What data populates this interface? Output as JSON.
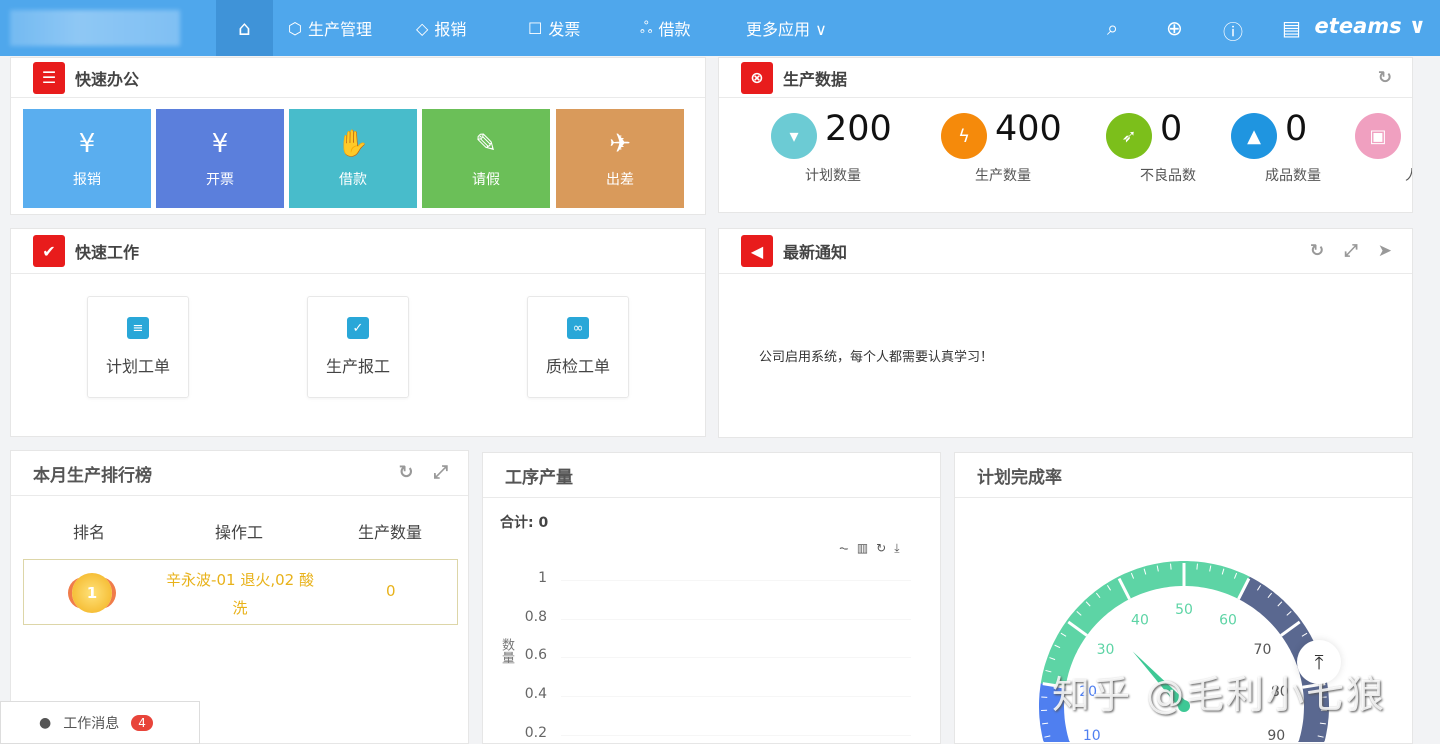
{
  "nav": {
    "items": [
      {
        "label": "生产管理",
        "icon": "cube-icon"
      },
      {
        "label": "报销",
        "icon": "diamond-icon"
      },
      {
        "label": "发票",
        "icon": "invoice-icon"
      },
      {
        "label": "借款",
        "icon": "org-icon"
      },
      {
        "label": "更多应用 ∨",
        "icon": ""
      }
    ],
    "brand": "eteams ∨"
  },
  "quick_office": {
    "title": "快速办公",
    "tiles": [
      {
        "label": "报销",
        "glyph": "¥",
        "color": "#5aaeef"
      },
      {
        "label": "开票",
        "glyph": "¥",
        "color": "#5b7fdc"
      },
      {
        "label": "借款",
        "glyph": "✋",
        "color": "#48bccb"
      },
      {
        "label": "请假",
        "glyph": "✎",
        "color": "#6bbf58"
      },
      {
        "label": "出差",
        "glyph": "✈",
        "color": "#d99a5b"
      }
    ]
  },
  "production_data": {
    "title": "生产数据",
    "stats": [
      {
        "value": "200",
        "label": "计划数量",
        "color": "#6ccbd4",
        "glyph": "▾"
      },
      {
        "value": "400",
        "label": "生产数量",
        "color": "#f58a0b",
        "glyph": "ϟ"
      },
      {
        "value": "0",
        "label": "不良品数",
        "color": "#7cbf1b",
        "glyph": "➶"
      },
      {
        "value": "0",
        "label": "成品数量",
        "color": "#1f95e0",
        "glyph": "▲"
      },
      {
        "value": "",
        "label": "人",
        "color": "#f0a0c0",
        "glyph": "▣"
      }
    ]
  },
  "quick_work": {
    "title": "快速工作",
    "items": [
      {
        "label": "计划工单",
        "glyph": "≡"
      },
      {
        "label": "生产报工",
        "glyph": "✓"
      },
      {
        "label": "质检工单",
        "glyph": "∞"
      }
    ]
  },
  "notice": {
    "title": "最新通知",
    "text": "公司启用系统，每个人都需要认真学习！"
  },
  "ranking": {
    "title": "本月生产排行榜",
    "headers": [
      "排名",
      "操作工",
      "生产数量"
    ],
    "rows": [
      {
        "rank": "1",
        "name": "辛永波-01 退火,02 酸洗",
        "qty": "0"
      }
    ]
  },
  "process": {
    "title": "工序产量",
    "total": "合计: 0",
    "ylabel": "数量"
  },
  "plan_rate": {
    "title": "计划完成率"
  },
  "messages": {
    "label": "工作消息",
    "count": "4"
  },
  "watermark": "知乎 @毛利小七狼",
  "chart_data": [
    {
      "type": "bar",
      "title": "工序产量",
      "ylabel": "数量",
      "ylim": [
        0,
        1
      ],
      "yticks": [
        "1",
        "0.8",
        "0.6",
        "0.4",
        "0.2"
      ],
      "categories": [],
      "values": []
    },
    {
      "type": "gauge",
      "title": "计划完成率",
      "min": 0,
      "max": 100,
      "ticks": [
        "10",
        "20",
        "30",
        "40",
        "50",
        "60",
        "70",
        "80",
        "90"
      ],
      "value": 34,
      "bands": [
        {
          "to": 20,
          "color": "#4f7ff0"
        },
        {
          "to": 60,
          "color": "#5dd4a5"
        },
        {
          "to": 100,
          "color": "#5a6890"
        }
      ]
    }
  ]
}
